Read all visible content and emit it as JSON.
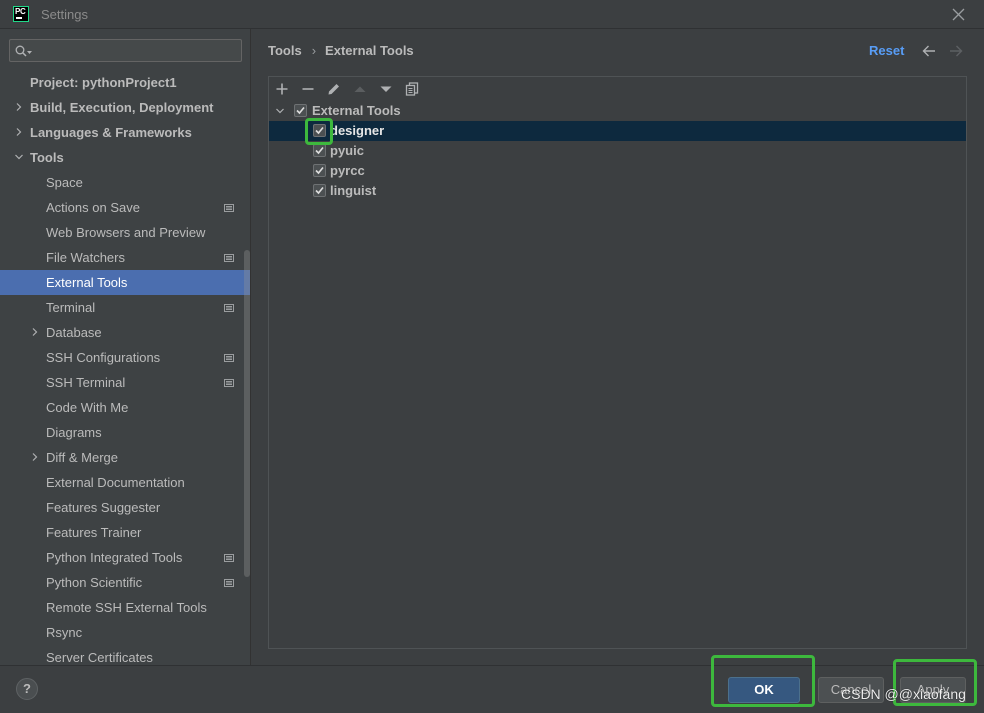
{
  "window": {
    "app_icon_text": "PC",
    "title": "Settings",
    "close_icon": "close-icon"
  },
  "search": {
    "value": "",
    "placeholder": "",
    "icon": "search-icon"
  },
  "sidebar": {
    "items": [
      {
        "label": "Project: pythonProject1",
        "expandable": false
      },
      {
        "label": "Build, Execution, Deployment",
        "expandable": true,
        "expanded": false
      },
      {
        "label": "Languages & Frameworks",
        "expandable": true,
        "expanded": false
      },
      {
        "label": "Tools",
        "expandable": true,
        "expanded": true,
        "children": [
          {
            "label": "Space"
          },
          {
            "label": "Actions on Save",
            "icon": "project-settings-icon"
          },
          {
            "label": "Web Browsers and Preview"
          },
          {
            "label": "File Watchers",
            "icon": "project-settings-icon"
          },
          {
            "label": "External Tools",
            "selected": true
          },
          {
            "label": "Terminal",
            "icon": "project-settings-icon"
          },
          {
            "label": "Database",
            "expandable": true,
            "expanded": false
          },
          {
            "label": "SSH Configurations",
            "icon": "project-settings-icon"
          },
          {
            "label": "SSH Terminal",
            "icon": "project-settings-icon"
          },
          {
            "label": "Code With Me"
          },
          {
            "label": "Diagrams"
          },
          {
            "label": "Diff & Merge",
            "expandable": true,
            "expanded": false
          },
          {
            "label": "External Documentation"
          },
          {
            "label": "Features Suggester"
          },
          {
            "label": "Features Trainer"
          },
          {
            "label": "Python Integrated Tools",
            "icon": "project-settings-icon"
          },
          {
            "label": "Python Scientific",
            "icon": "project-settings-icon"
          },
          {
            "label": "Remote SSH External Tools"
          },
          {
            "label": "Rsync"
          },
          {
            "label": "Server Certificates"
          }
        ]
      }
    ]
  },
  "breadcrumb": {
    "items": [
      "Tools",
      "External Tools"
    ],
    "separator": "›"
  },
  "header": {
    "reset_label": "Reset",
    "back_icon": "arrow-left-icon",
    "forward_icon": "arrow-right-icon",
    "forward_disabled": true
  },
  "tools_toolbar": {
    "items": [
      {
        "icon": "add-icon"
      },
      {
        "icon": "remove-icon"
      },
      {
        "icon": "edit-icon"
      },
      {
        "icon": "move-up-icon",
        "disabled": true
      },
      {
        "icon": "move-down-icon"
      },
      {
        "icon": "copy-icon"
      }
    ]
  },
  "tools_tree": {
    "group": {
      "label": "External Tools",
      "checked": true,
      "expanded": true
    },
    "items": [
      {
        "label": "designer",
        "checked": true,
        "selected": true
      },
      {
        "label": "pyuic",
        "checked": true
      },
      {
        "label": "pyrcc",
        "checked": true
      },
      {
        "label": "linguist",
        "checked": true
      }
    ]
  },
  "footer": {
    "help_label": "?",
    "ok_label": "OK",
    "cancel_label": "Cancel",
    "apply_label": "Apply"
  },
  "watermark": "CSDN @@xiaofang",
  "colors": {
    "accent": "#4b6eaf",
    "link": "#589df6",
    "ok_button": "#365880",
    "tree_selection": "#0d293e",
    "annotation": "#3db83d",
    "background": "#3c3f41",
    "text": "#bbbbbb"
  }
}
